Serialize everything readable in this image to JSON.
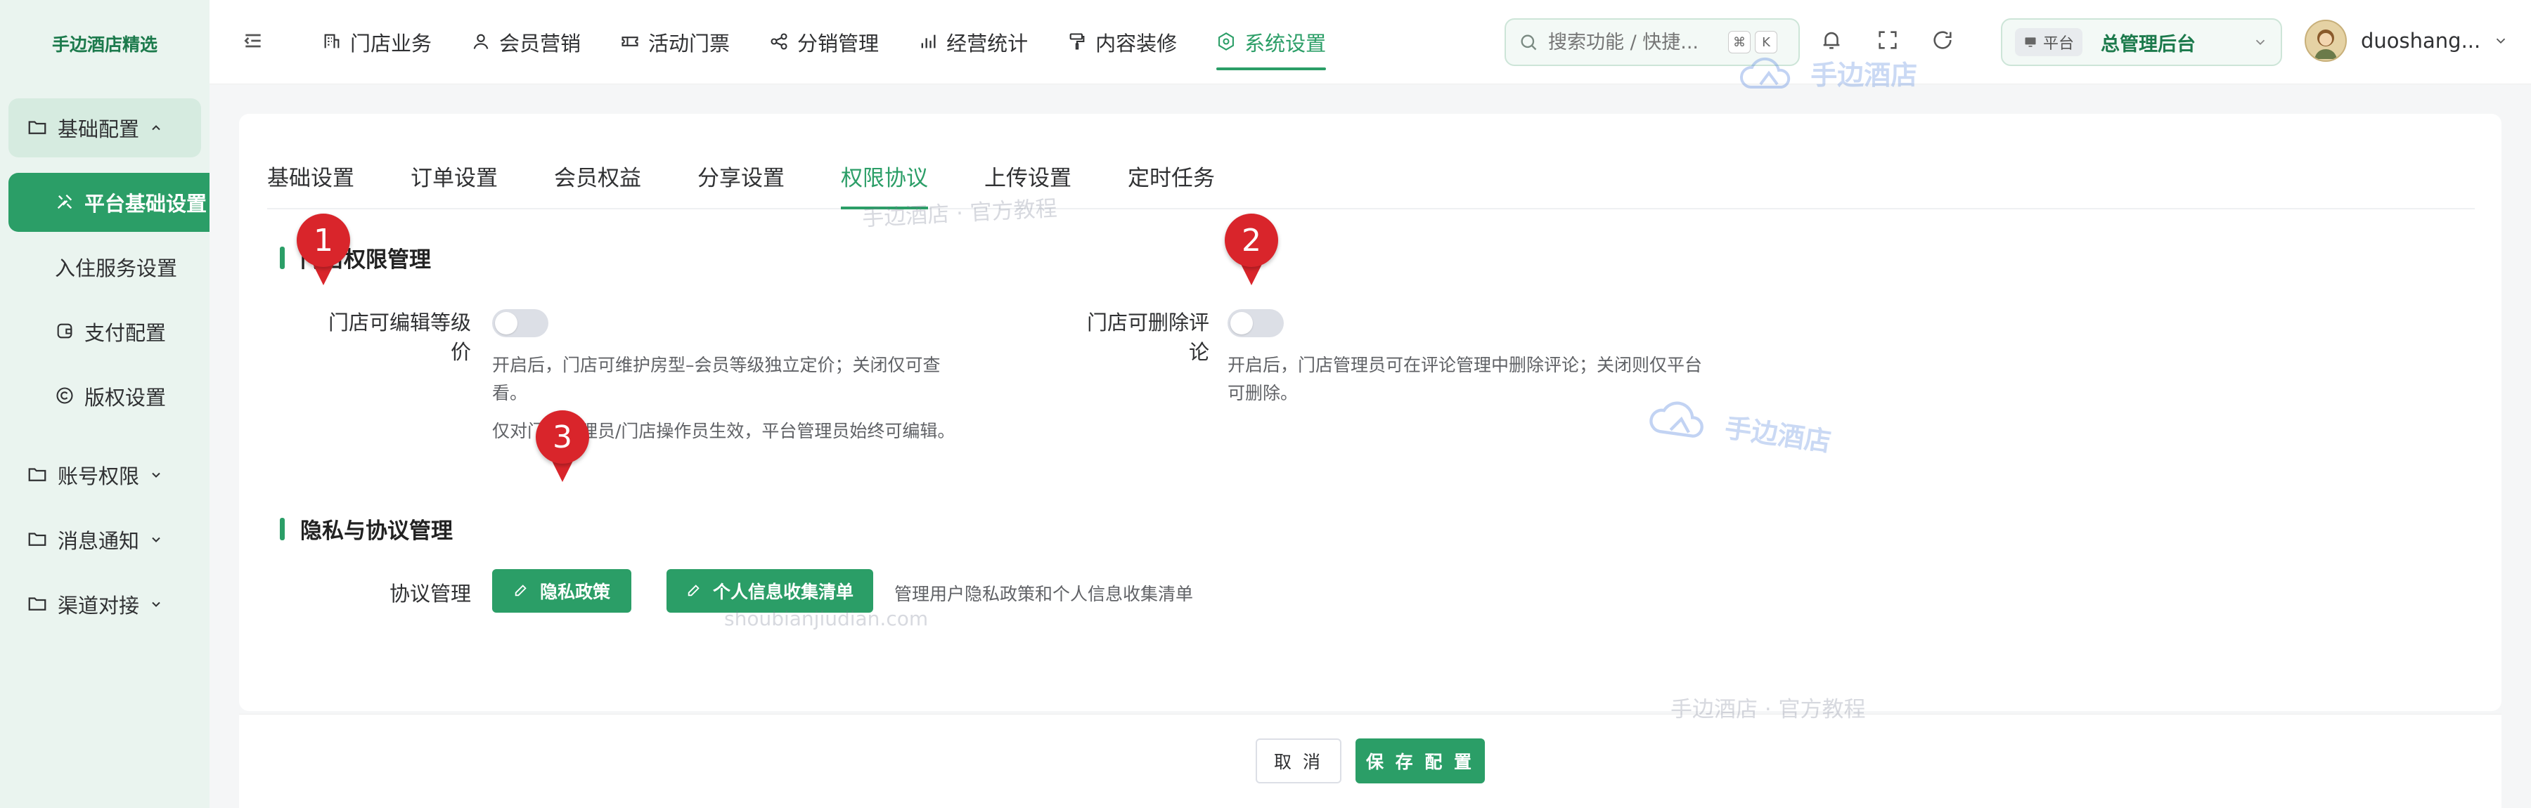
{
  "sidebar": {
    "logo": "手边酒店精选",
    "groups": [
      {
        "label": "基础配置",
        "items": [
          "平台基础设置",
          "入住服务设置",
          "支付配置",
          "版权设置"
        ]
      },
      {
        "label": "账号权限"
      },
      {
        "label": "消息通知"
      },
      {
        "label": "渠道对接"
      }
    ]
  },
  "topnav": {
    "items": [
      "门店业务",
      "会员营销",
      "活动门票",
      "分销管理",
      "经营统计",
      "内容装修",
      "系统设置"
    ],
    "active": "系统设置",
    "search_placeholder": "搜索功能 / 快捷...",
    "kbd_cmd": "⌘",
    "kbd_k": "K",
    "role_badge": "平台",
    "role_name": "总管理后台",
    "username": "duoshang..."
  },
  "tabs": [
    "基础设置",
    "订单设置",
    "会员权益",
    "分享设置",
    "权限协议",
    "上传设置",
    "定时任务"
  ],
  "active_tab": "权限协议",
  "permissions": {
    "title": "门店权限管理",
    "edit_level_label": "门店可编辑等级价",
    "edit_level_desc_line1": "开启后，门店可维护房型–会员等级独立定价；关闭仅可查",
    "edit_level_desc_line2": "看。",
    "edit_level_note": "仅对门店管理员/门店操作员生效，平台管理员始终可编辑。",
    "delete_review_label": "门店可删除评论",
    "delete_review_desc_line1": "开启后，门店管理员可在评论管理中删除评论；关闭则仅平台",
    "delete_review_desc_line2": "可删除。"
  },
  "privacy": {
    "title": "隐私与协议管理",
    "label": "协议管理",
    "privacy_btn": "隐私政策",
    "info_btn": "个人信息收集清单",
    "hint": "管理用户隐私政策和个人信息收集清单"
  },
  "footer": {
    "cancel": "取 消",
    "save": "保 存 配 置"
  },
  "markers": [
    "1",
    "2",
    "3"
  ],
  "watermarks": {
    "brand": "手边酒店",
    "tutorial": "手边酒店 · 官方教程",
    "domain": "shoubianjiudian.com"
  },
  "colors": {
    "accent": "#2b9e67",
    "sidebar_bg": "#eaf4ef",
    "marker": "#d9252b"
  }
}
